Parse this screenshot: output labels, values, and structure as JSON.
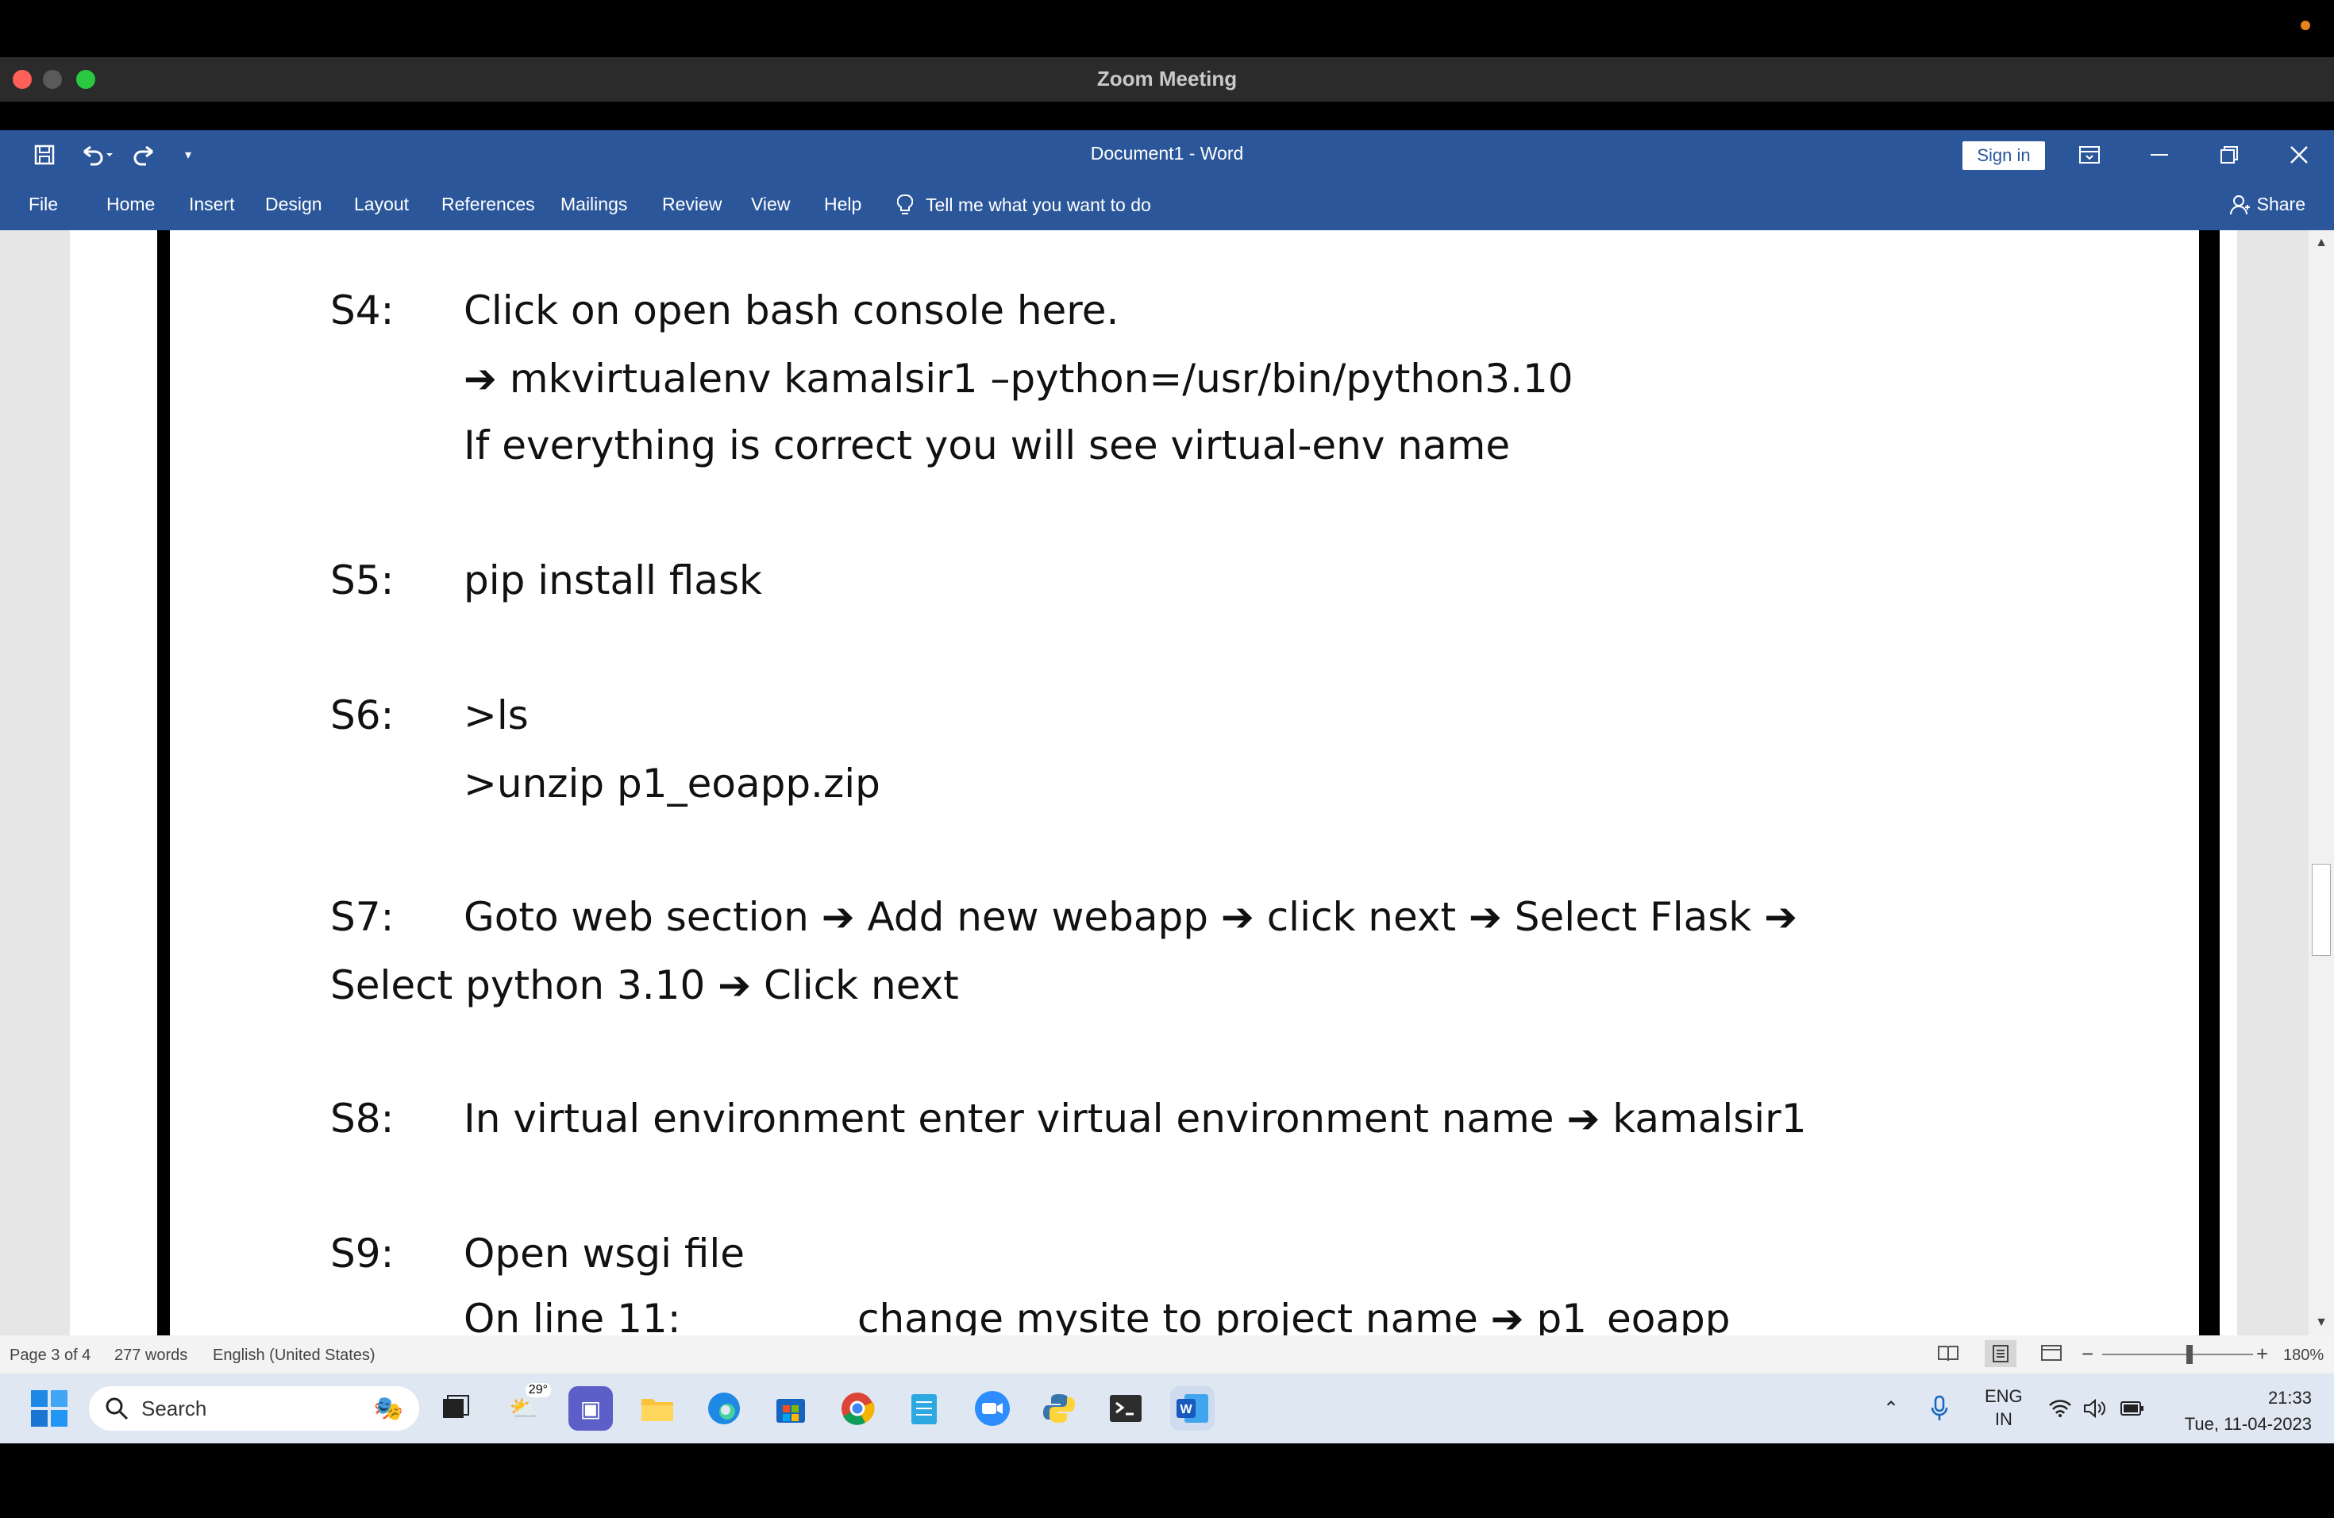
{
  "zoom": {
    "title": "Zoom Meeting"
  },
  "word": {
    "doc_title": "Document1  -  Word",
    "sign_in": "Sign in",
    "tabs": [
      "File",
      "Home",
      "Insert",
      "Design",
      "Layout",
      "References",
      "Mailings",
      "Review",
      "View",
      "Help"
    ],
    "tell_me": "Tell me what you want to do",
    "share": "Share"
  },
  "document": {
    "s4": {
      "label": "S4:",
      "line1": "Click on open bash console here.",
      "line2": "mkvirtualenv kamalsir1 –python=/usr/bin/python3.10",
      "line3": "If everything is correct you will see virtual-env name"
    },
    "s5": {
      "label": "S5:",
      "line1": "pip install flask"
    },
    "s6": {
      "label": "S6:",
      "line1": ">ls",
      "line2": ">unzip p1_eoapp.zip"
    },
    "s7": {
      "label": "S7:",
      "p1": "Goto web section",
      "p2": "Add new webapp",
      "p3": "click next",
      "p4": "Select Flask",
      "p5": "Select python 3.10",
      "p6": "Click next"
    },
    "s8": {
      "label": "S8:",
      "p1": "In virtual environment enter virtual environment name",
      "p2": "kamalsir1"
    },
    "s9": {
      "label": "S9:",
      "line1": "Open wsgi file",
      "line2a": "On line 11:",
      "line2b": "change mysite to project name",
      "line2c": "p1_eoapp"
    },
    "arrow": "➔"
  },
  "status": {
    "page": "Page 3 of 4",
    "words": "277 words",
    "language": "English (United States)",
    "zoom": "180%"
  },
  "taskbar": {
    "search_label": "Search",
    "weather": "29°",
    "lang_top": "ENG",
    "lang_bottom": "IN",
    "time": "21:33",
    "date": "Tue, 11-04-2023"
  },
  "colors": {
    "word_blue": "#2b579a",
    "taskbar": "#dfe7f3"
  }
}
